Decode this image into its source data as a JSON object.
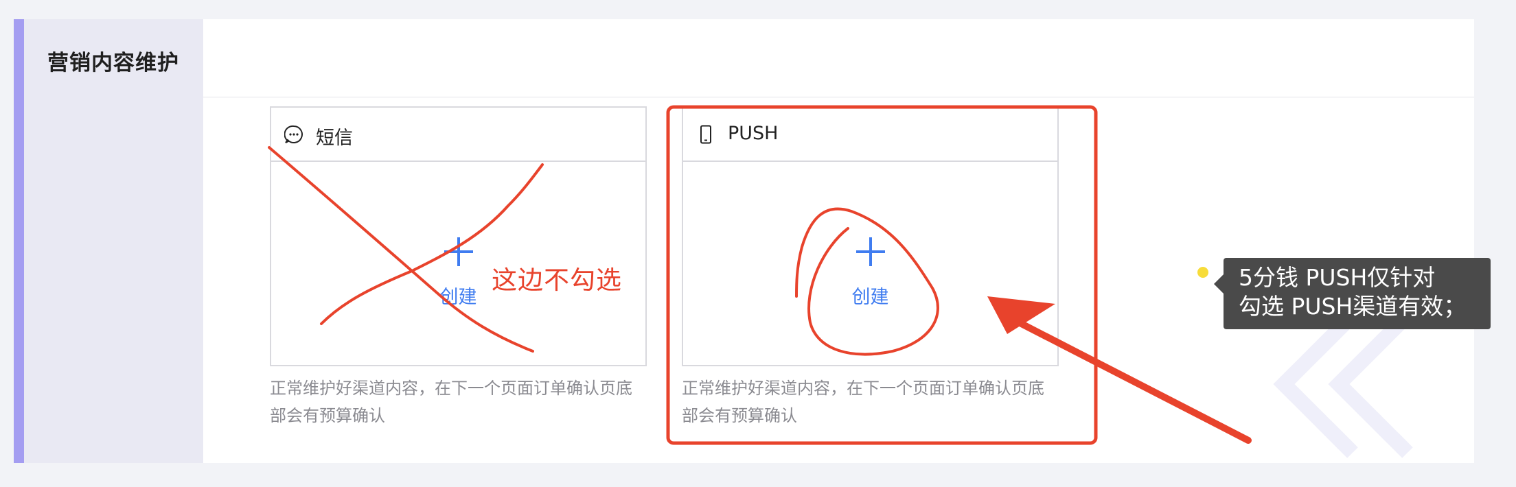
{
  "section": {
    "title": "营销内容维护"
  },
  "channels": [
    {
      "name": "短信",
      "icon": "chat-bubble-icon",
      "create_label": "创建",
      "description_line1": "正常维护好渠道内容，在下一个页面订单确认页底",
      "description_line2": "部会有预算确认"
    },
    {
      "name": "PUSH",
      "icon": "mobile-phone-icon",
      "create_label": "创建",
      "description_line1": "正常维护好渠道内容，在下一个页面订单确认页底",
      "description_line2": "部会有预算确认"
    }
  ],
  "annotations": {
    "cross_out_note": "这边不勾选",
    "tooltip_line1": "5分钱 PUSH仅针对",
    "tooltip_line2": "勾选 PUSH渠道有效；"
  },
  "colors": {
    "accent": "#a49df1",
    "link": "#3f7cf0",
    "annotation_red": "#e8432c",
    "tooltip_bg": "#4a4a4a"
  }
}
